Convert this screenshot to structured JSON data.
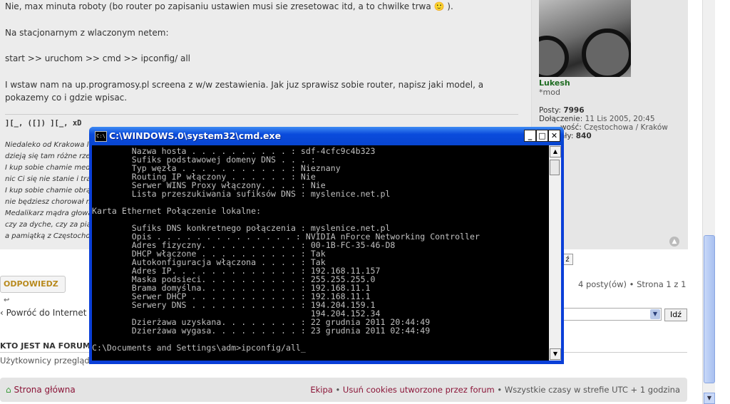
{
  "post": {
    "lines": [
      "Nie, max minuta roboty (bo router po zapisaniu ustawien musi sie zresetowac itd, a to chwilke trwa 🙂 ).",
      "Na stacjonarnym z wlaczonym netem:",
      "start >> uruchom >> cmd >> ipconfig/ all",
      "I wstaw nam na up.programosy.pl screena z w/w zestawienia. Jak juz sprawisz sobie router, napisz jaki model, a",
      "pokazemy co i gdzie wpisac."
    ],
    "signature_header": "][_, ([]) ][_, xD",
    "signature_lines": [
      "Niedaleko od Krakowa leż",
      "dzieją się tam różne rzec",
      "I kup sobie chamie meda",
      "nic Ci się nie stanie i trai",
      "I kup sobie chamie obrąc",
      "nie będziesz chorował na",
      "Medalikarz mądra głowa,",
      "czy za dyche, czy za piąt",
      "a pamiątką z Częstochow"
    ]
  },
  "profile": {
    "username": "Lukesh",
    "rank": "*mod",
    "posts_label": "Posty:",
    "posts_value": "7996",
    "joined_label": "Dołączenie:",
    "joined_value": "11 Lis 2005, 20:45",
    "location_label": "wość:",
    "location_value": "Częstochowa / Kraków",
    "extra_label": "ały:",
    "extra_value": "840"
  },
  "actions": {
    "reply_label": "ODPOWIEDZ",
    "back_label": "Powróć do Internet",
    "posts_info": "4 posty(ów) • Strona 1 z 1",
    "go_label": "Idź",
    "small_btn": "ź"
  },
  "who": {
    "title": "KTO JEST NA FORUM",
    "text": "Użytkownicy przegląd"
  },
  "footer": {
    "home_label": "Strona główna",
    "team_label": "Ekipa",
    "sep1": "•",
    "cookies_label": "Usuń cookies utworzone przez forum",
    "sep2": "•",
    "timezone_text": "Wszystkie czasy w strefie UTC + 1 godzina"
  },
  "cmd": {
    "title": "C:\\WINDOWS.0\\system32\\cmd.exe",
    "icon_text": "C:\\",
    "minimize": "_",
    "maximize": "□",
    "close": "✕",
    "output": "        Nazwa hosta . . . . . . . . . . : sdf-4cfc9c4b323\n        Sufiks podstawowej domeny DNS . . . :\n        Typ węzła . . . . . . . . . . . : Nieznany\n        Routing IP włączony . . . . . . : Nie\n        Serwer WINS Proxy włączony. . . . : Nie\n        Lista przeszukiwania sufiksów DNS : myslenice.net.pl\n\nKarta Ethernet Połączenie lokalne:\n\n        Sufiks DNS konkretnego połączenia : myslenice.net.pl\n        Opis . . . . . . . . . . . . . . : NVIDIA nForce Networking Controller\n        Adres fizyczny. . . . . . . . . . : 00-1B-FC-35-46-D8\n        DHCP włączone . . . . . . . . . . : Tak\n        Autokonfiguracja włączona . . . . : Tak\n        Adres IP. . . . . . . . . . . . . : 192.168.11.157\n        Maska podsieci. . . . . . . . . . : 255.255.255.0\n        Brama domyślna. . . . . . . . . . : 192.168.11.1\n        Serwer DHCP . . . . . . . . . . . : 192.168.11.1\n        Serwery DNS . . . . . . . . . . . : 194.204.159.1\n                                            194.204.152.34\n        Dzierżawa uzyskana. . . . . . . . : 22 grudnia 2011 20:44:49\n        Dzierżawa wygasa. . . . . . . . . : 23 grudnia 2011 02:44:49\n\nC:\\Documents and Settings\\adm>ipconfig/all_"
  }
}
